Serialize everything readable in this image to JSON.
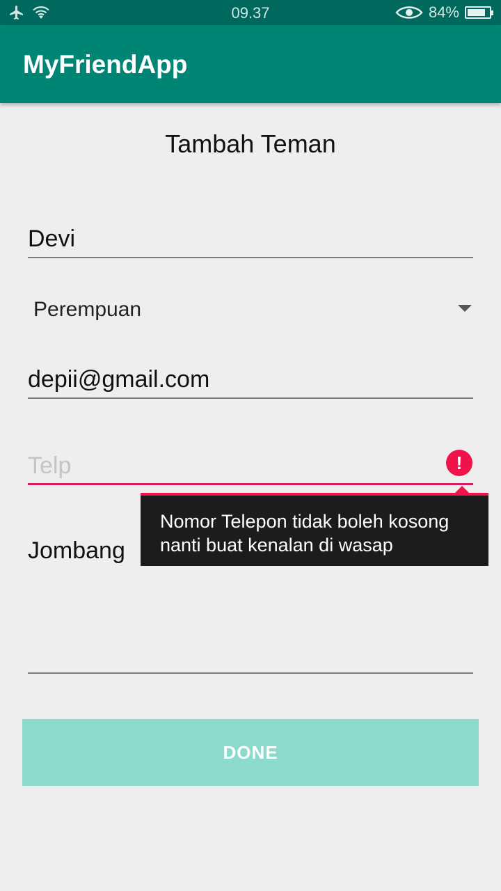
{
  "status_bar": {
    "time": "09.37",
    "battery_percent": "84%",
    "battery_level": 0.84,
    "icons": [
      "airplane-icon",
      "wifi-icon",
      "eye-icon",
      "battery-icon"
    ]
  },
  "app_bar": {
    "title": "MyFriendApp",
    "color": "#008575"
  },
  "form": {
    "heading": "Tambah Teman",
    "name_value": "Devi",
    "gender_selected": "Perempuan",
    "email_value": "depii@gmail.com",
    "phone_placeholder": "Telp",
    "phone_value": "",
    "phone_error": "Nomor Telepon tidak boleh kosong nanti buat kenalan di wasap",
    "address_value": "Jombang",
    "done_label": "DONE"
  },
  "colors": {
    "accent": "#d81b60",
    "error": "#f0124b",
    "button": "#8cdacb"
  }
}
